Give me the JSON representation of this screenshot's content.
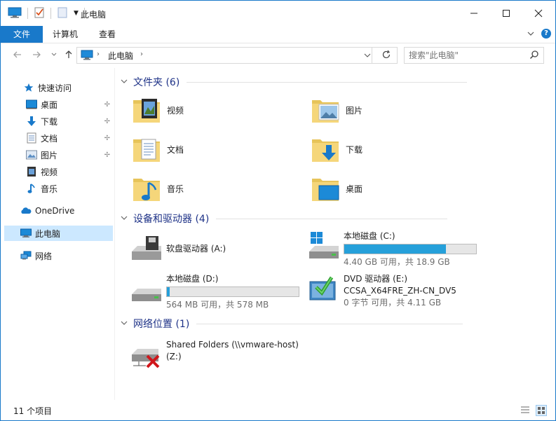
{
  "window": {
    "title": "此电脑"
  },
  "ribbon": {
    "tabs": [
      "文件",
      "计算机",
      "查看"
    ]
  },
  "address": {
    "path": "此电脑"
  },
  "search": {
    "placeholder": "搜索\"此电脑\""
  },
  "nav": {
    "quick_access": "快速访问",
    "pinned": [
      {
        "label": "桌面",
        "icon": "desktop-icon",
        "pinned": true
      },
      {
        "label": "下载",
        "icon": "download-icon",
        "pinned": true
      },
      {
        "label": "文档",
        "icon": "documents-icon",
        "pinned": true
      },
      {
        "label": "图片",
        "icon": "pictures-icon",
        "pinned": true
      },
      {
        "label": "视频",
        "icon": "videos-icon",
        "pinned": false
      },
      {
        "label": "音乐",
        "icon": "music-icon",
        "pinned": false
      }
    ],
    "onedrive": "OneDrive",
    "this_pc": "此电脑",
    "network": "网络"
  },
  "groups": {
    "folders": "文件夹 (6)",
    "devices": "设备和驱动器 (4)",
    "network": "网络位置 (1)"
  },
  "folders": [
    "视频",
    "图片",
    "文档",
    "下载",
    "音乐",
    "桌面"
  ],
  "drives": {
    "floppy": {
      "name": "软盘驱动器 (A:)"
    },
    "c": {
      "name": "本地磁盘 (C:)",
      "free": "4.40 GB 可用，共 18.9 GB",
      "used_fraction": 0.77
    },
    "d": {
      "name": "本地磁盘 (D:)",
      "free": "564 MB 可用，共 578 MB",
      "used_fraction": 0.02
    },
    "e": {
      "name": "DVD 驱动器 (E:)",
      "label": "CCSA_X64FRE_ZH-CN_DV5",
      "free": "0 字节 可用，共 4.11 GB"
    }
  },
  "network_location": {
    "line1": "Shared Folders (\\\\vmware-host)",
    "line2": "(Z:)"
  },
  "status": {
    "items": "11 个项目"
  },
  "colors": {
    "accent": "#1979ca",
    "bar_fill": "#26a0da",
    "group_header": "#1e3287",
    "selected": "#cce8ff"
  }
}
